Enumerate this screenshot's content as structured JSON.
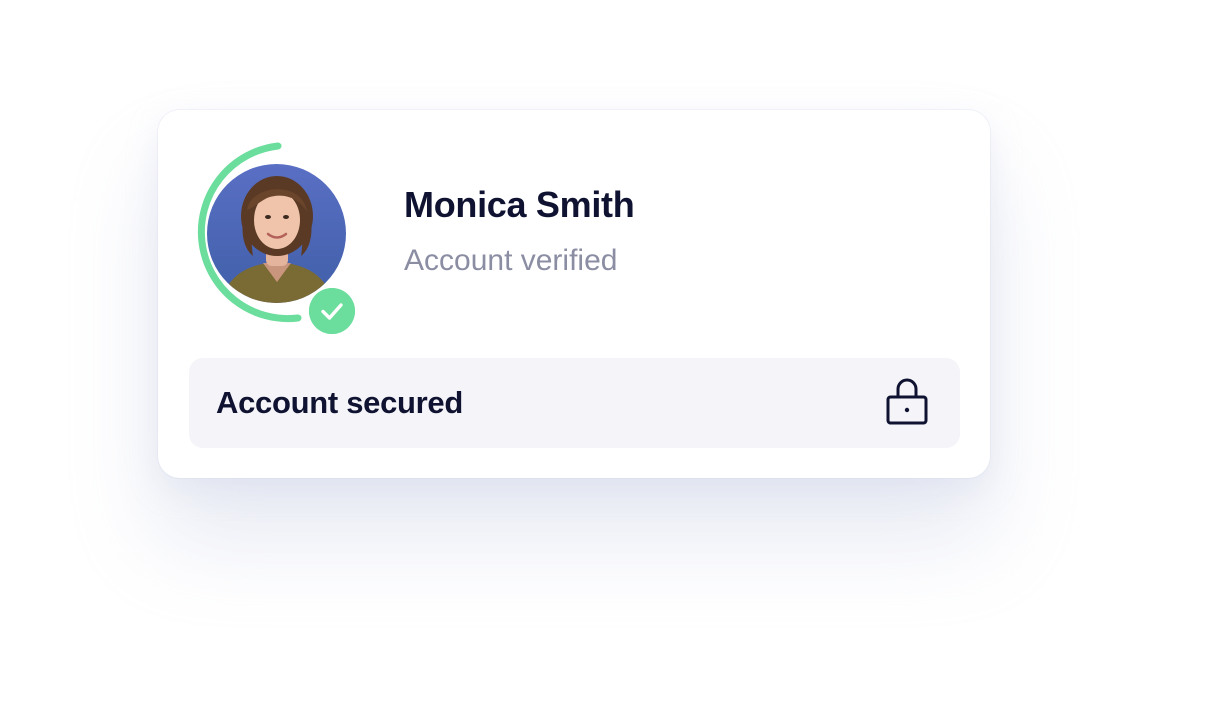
{
  "profile": {
    "name": "Monica Smith",
    "status": "Account verified"
  },
  "security": {
    "label": "Account secured",
    "icon": "lock-icon"
  },
  "avatar": {
    "icon": "avatar",
    "badge_icon": "check-icon"
  },
  "colors": {
    "accent_green": "#6bdd9c",
    "title": "#0f1230",
    "muted": "#8b8da3",
    "row_background": "#f4f4f9"
  }
}
